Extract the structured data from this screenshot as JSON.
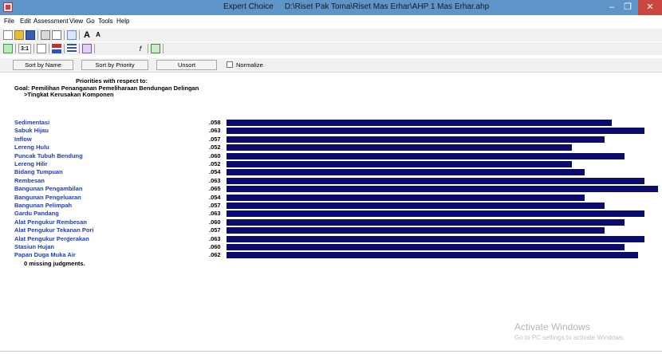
{
  "window": {
    "title_app": "Expert Choice",
    "title_path": "D:\\Riset Pak Toma\\Riset Mas Erhar\\AHP 1 Mas Erhar.ahp",
    "min_glyph": "–",
    "max_glyph": "❐",
    "close_glyph": "✕"
  },
  "menu": [
    "File",
    "Edit",
    "Assessment",
    "View",
    "Go",
    "Tools",
    "Help"
  ],
  "toolbar": {
    "ratio_label": "3:1"
  },
  "sortbar": {
    "sort_name": "Sort by Name",
    "sort_priority": "Sort by Priority",
    "unsort": "Unsort",
    "normalize": "Normalize"
  },
  "content": {
    "header": "Priorities with respect to:",
    "goal": "Goal: Pemilihan Penanganan Pemeliharaan Bendungan Delingan",
    "subgoal": ">Tingkat Kerusakan Komponen",
    "missing": "0  missing judgments."
  },
  "chart_data": {
    "type": "bar",
    "categories": [
      "Sedimentasi",
      "Sabuk Hijau",
      "Inflow",
      "Lereng Hulu",
      "Puncak Tubuh Bendung",
      "Lereng Hilir",
      "Bidang Tumpuan",
      "Rembesan",
      "Bangunan Pengambilan",
      "Bangunan Pengeluaran",
      "Bangunan Pelimpah",
      "Gardu Pandang",
      "Alat Pengukur Rembesan",
      "Alat Pengukur Tekanan Pori",
      "Alat Pengukur Pergerakan",
      "Stasiun Hujan",
      "Papan Duga Muka Air"
    ],
    "labels": [
      ".058",
      ".063",
      ".057",
      ".052",
      ".060",
      ".052",
      ".054",
      ".063",
      ".065",
      ".054",
      ".057",
      ".063",
      ".060",
      ".057",
      ".063",
      ".060",
      ".062"
    ],
    "values": [
      0.058,
      0.063,
      0.057,
      0.052,
      0.06,
      0.052,
      0.054,
      0.063,
      0.065,
      0.054,
      0.057,
      0.063,
      0.06,
      0.057,
      0.063,
      0.06,
      0.062
    ],
    "bar_color": "#0b0b6e",
    "label_color": "#1c3cc8"
  },
  "watermark": {
    "line1": "Activate Windows",
    "line2": "Go to PC settings to activate Windows."
  }
}
